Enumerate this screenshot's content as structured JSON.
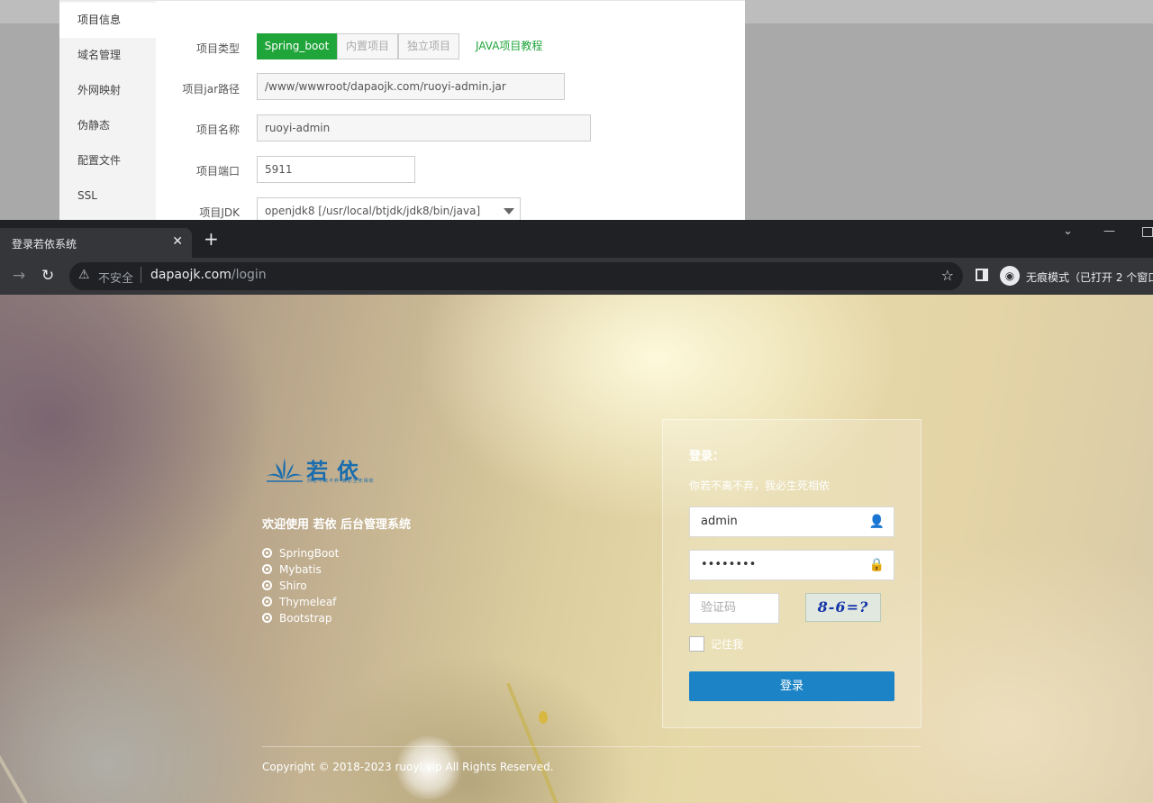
{
  "panel": {
    "sidebar": [
      "项目信息",
      "域名管理",
      "外网映射",
      "伪静态",
      "配置文件",
      "SSL"
    ],
    "fields": {
      "type_label": "项目类型",
      "type_options": [
        "Spring_boot",
        "内置项目",
        "独立项目"
      ],
      "type_selected": "Spring_boot",
      "tutorial_link": "JAVA项目教程",
      "jar_label": "项目jar路径",
      "jar_value": "/www/wwwroot/dapaojk.com/ruoyi-admin.jar",
      "name_label": "项目名称",
      "name_value": "ruoyi-admin",
      "port_label": "项目端口",
      "port_value": "5911",
      "jdk_label": "项目JDK",
      "jdk_value": "openjdk8 [/usr/local/btjdk/jdk8/bin/java]"
    }
  },
  "browser": {
    "tab_title": "登录若依系统",
    "security_label": "不安全",
    "url_host": "dapaojk.com",
    "url_path": "/login",
    "incognito_label": "无痕模式（已打开 2 个窗口"
  },
  "login_page": {
    "logo_text": "若依",
    "logo_subtitle": "你若不离不弃 我必生死相依",
    "welcome": "欢迎使用 若依 后台管理系统",
    "features": [
      "SpringBoot",
      "Mybatis",
      "Shiro",
      "Thymeleaf",
      "Bootstrap"
    ],
    "form": {
      "title": "登录：",
      "subtitle": "你若不离不弃，我必生死相依",
      "username": "admin",
      "password": "••••••••",
      "captcha_placeholder": "验证码",
      "captcha_image_text": "8-6=?",
      "remember_label": "记住我",
      "submit_label": "登录"
    },
    "copyright": "Copyright © 2018-2023 ruoyi.vip All Rights Reserved."
  },
  "colors": {
    "bt_green": "#20a53a",
    "login_button": "#1c84c6",
    "logo_blue": "#1b6dad"
  }
}
